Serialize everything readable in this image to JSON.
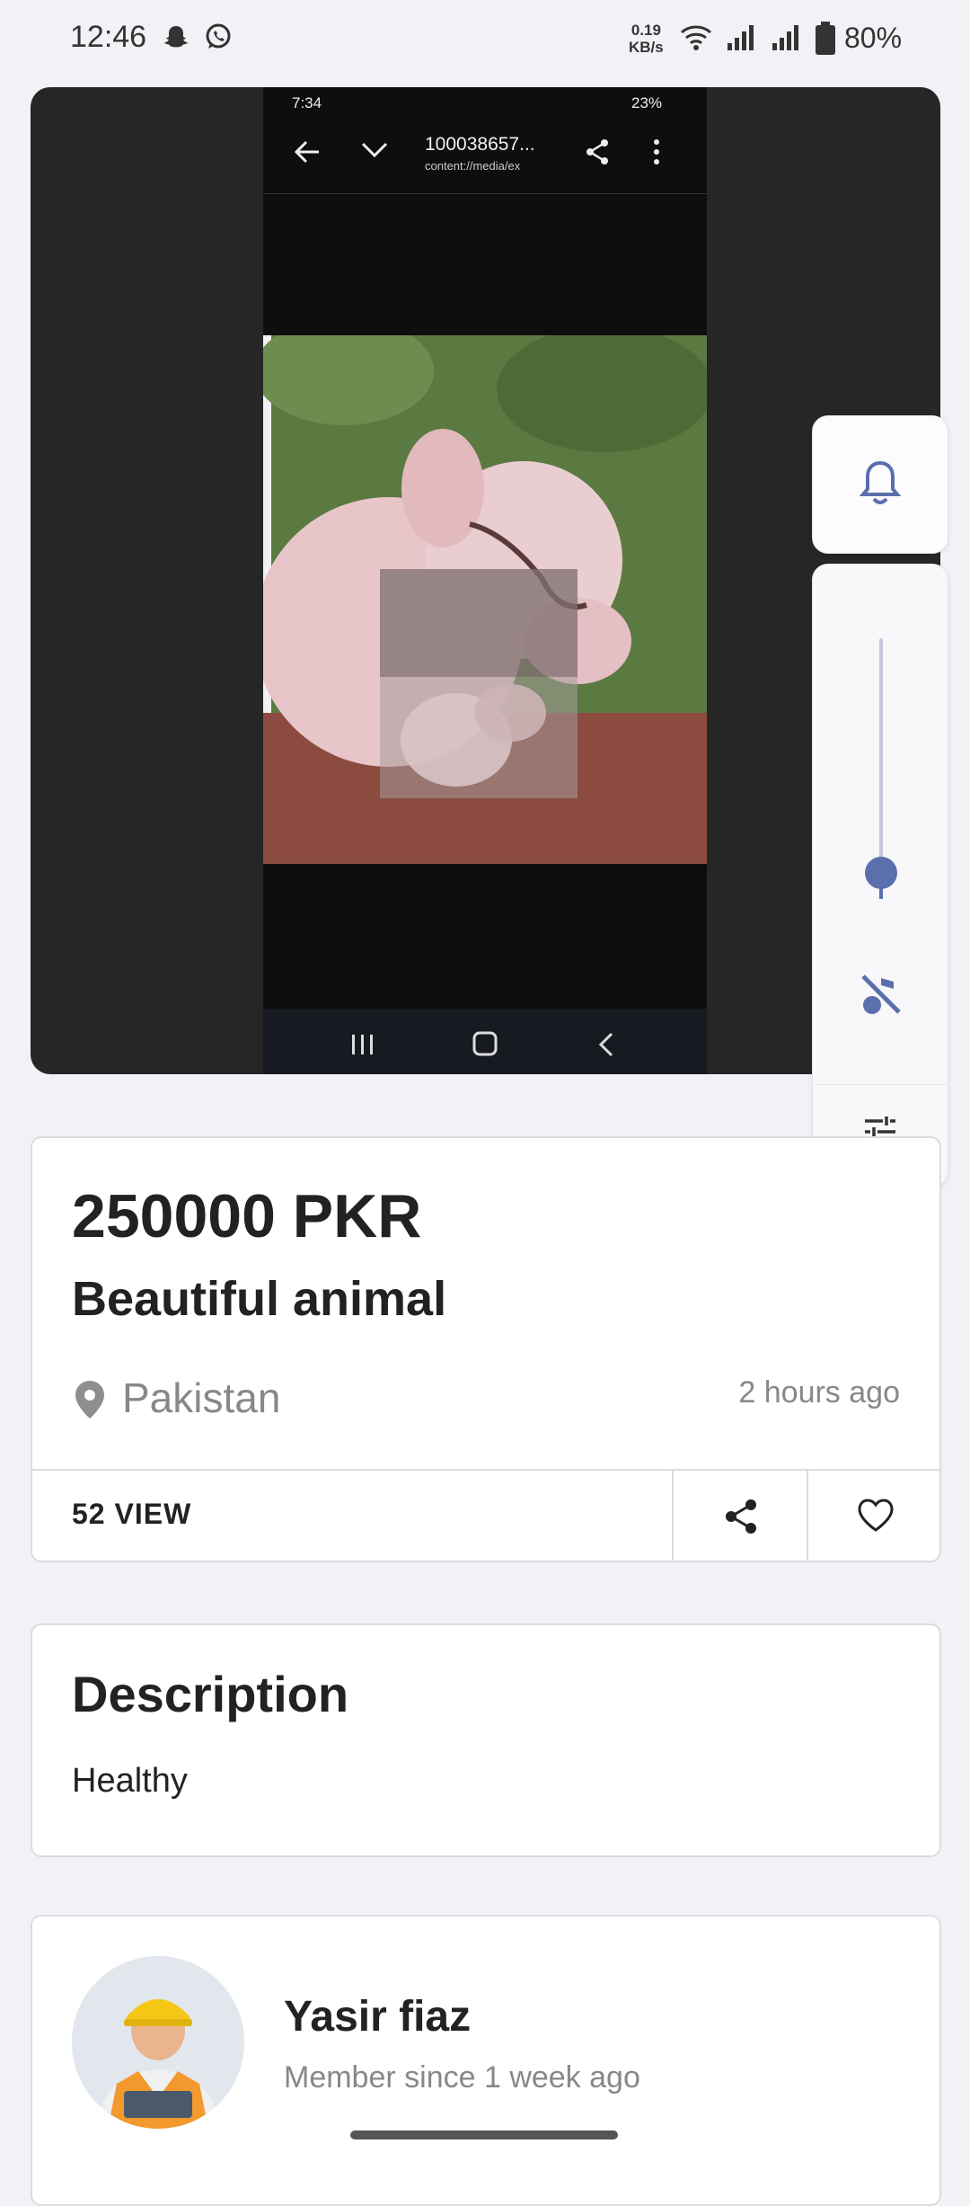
{
  "status_bar": {
    "time": "12:46",
    "net_speed_value": "0.19",
    "net_speed_unit": "KB/s",
    "battery": "80%",
    "icons": [
      "snapchat-icon",
      "whatsapp-icon",
      "wifi-icon",
      "signal-icon",
      "signal-icon",
      "battery-icon"
    ]
  },
  "media": {
    "inner_status_time": "7:34",
    "inner_battery": "23%",
    "inner_title": "100038657...",
    "inner_subtitle": "content://media/ex"
  },
  "volume_panel": {
    "level": 0.1,
    "icons": [
      "bell-icon",
      "music-off-icon",
      "tune-icon"
    ],
    "accent": "#5b6fad"
  },
  "listing": {
    "price": "250000 PKR",
    "title": "Beautiful animal",
    "location": "Pakistan",
    "posted": "2 hours ago",
    "views": "52 VIEW"
  },
  "description": {
    "heading": "Description",
    "text": "Healthy"
  },
  "seller": {
    "name": "Yasir fiaz",
    "member_since": "Member since 1 week ago"
  }
}
